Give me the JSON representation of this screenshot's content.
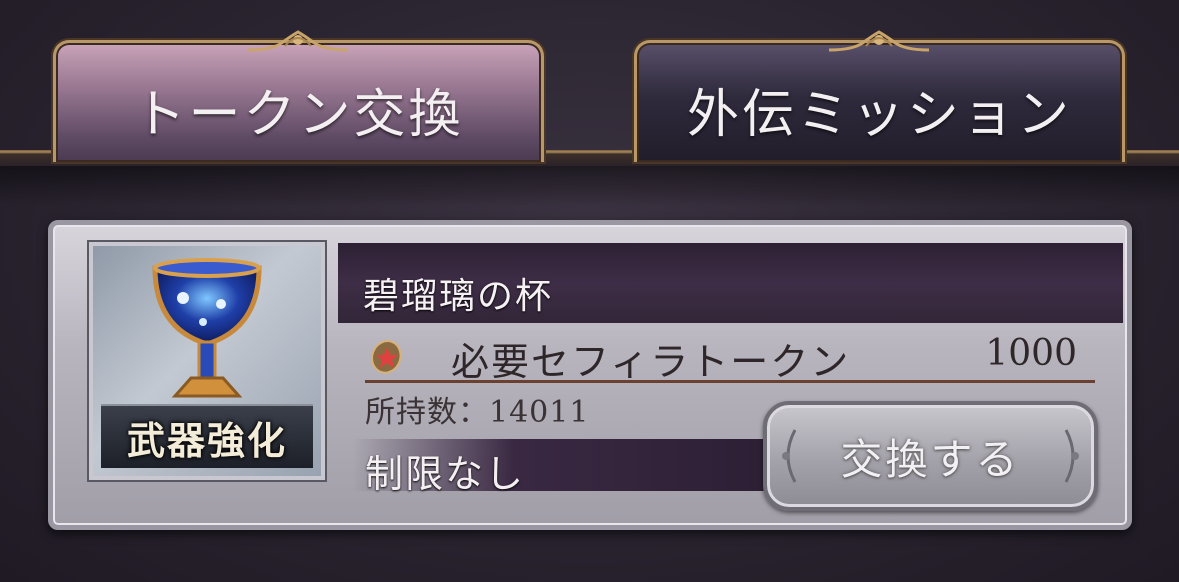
{
  "tabs": [
    {
      "label": "トークン交換",
      "active": true
    },
    {
      "label": "外伝ミッション",
      "active": false
    }
  ],
  "item": {
    "name": "碧瑠璃の杯",
    "badge": "武器強化",
    "icon": "chalice-icon",
    "cost_label": "必要セフィラトークン",
    "cost_value": "1000",
    "cost_icon": "sefira-token-icon",
    "owned_label": "所持数：",
    "owned_value": "14011",
    "limit": "制限なし",
    "exchange_button": "交換する"
  },
  "colors": {
    "active_tab": "#9c7a94",
    "inactive_tab": "#2f2a3c",
    "gold_trim": "#b89866",
    "card": "#b8b5bf",
    "name_bar": "#3e2d46"
  }
}
